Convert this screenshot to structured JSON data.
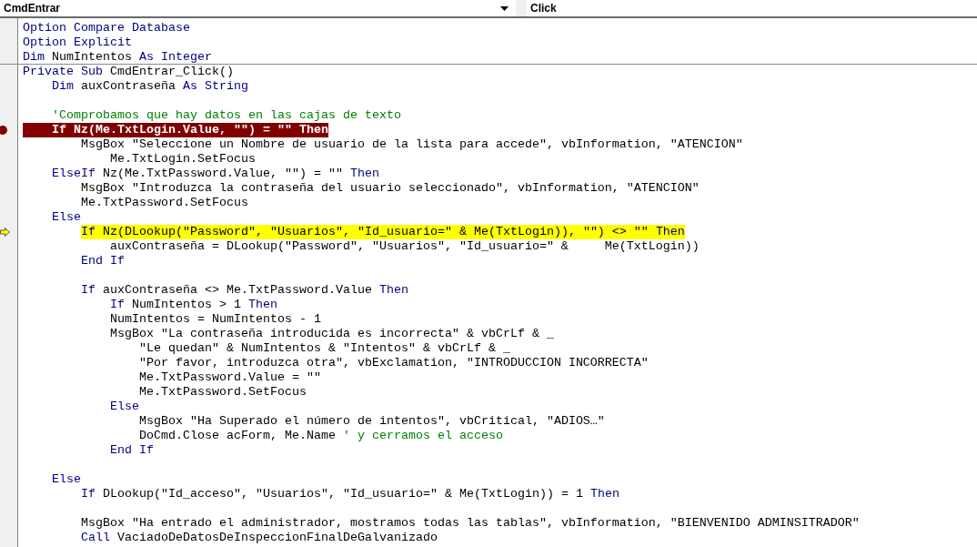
{
  "object_dropdown": {
    "value": "CmdEntrar"
  },
  "procedure_dropdown": {
    "value": "Click"
  },
  "lines": [
    {
      "kind": "code",
      "breakpoint": false,
      "current": false,
      "parts": [
        {
          "kind": "keyword",
          "text": "Option Compare Database"
        }
      ]
    },
    {
      "kind": "code",
      "breakpoint": false,
      "current": false,
      "parts": [
        {
          "kind": "keyword",
          "text": "Option Explicit"
        }
      ]
    },
    {
      "kind": "code",
      "breakpoint": false,
      "current": false,
      "parts": [
        {
          "kind": "keyword",
          "text": "Dim"
        },
        {
          "kind": "plain",
          "text": " NumIntentos "
        },
        {
          "kind": "keyword",
          "text": "As Integer"
        }
      ]
    },
    {
      "kind": "procedure_start",
      "breakpoint": false,
      "current": false,
      "parts": [
        {
          "kind": "keyword",
          "text": "Private Sub"
        },
        {
          "kind": "plain",
          "text": " CmdEntrar_Click()"
        }
      ]
    },
    {
      "kind": "code",
      "breakpoint": false,
      "current": false,
      "parts": [
        {
          "kind": "keyword",
          "text": "    Dim"
        },
        {
          "kind": "plain",
          "text": " auxContraseña "
        },
        {
          "kind": "keyword",
          "text": "As String"
        }
      ]
    },
    {
      "kind": "blank"
    },
    {
      "kind": "code",
      "breakpoint": false,
      "current": false,
      "parts": [
        {
          "kind": "comment",
          "text": "    'Comprobamos que hay datos en las cajas de texto"
        }
      ]
    },
    {
      "kind": "code",
      "breakpoint": true,
      "current": false,
      "parts": [
        {
          "kind": "keyword",
          "text": "    If"
        },
        {
          "kind": "plain",
          "text": " Nz(Me.TxtLogin.Value, \"\") = \"\" "
        },
        {
          "kind": "keyword",
          "text": "Then"
        }
      ]
    },
    {
      "kind": "code",
      "breakpoint": false,
      "current": false,
      "parts": [
        {
          "kind": "plain",
          "text": "        MsgBox \"Seleccione un Nombre de usuario de la lista para accede\", vbInformation, \"ATENCION\""
        }
      ]
    },
    {
      "kind": "code",
      "breakpoint": false,
      "current": false,
      "parts": [
        {
          "kind": "plain",
          "text": "            Me.TxtLogin.SetFocus"
        }
      ]
    },
    {
      "kind": "code",
      "breakpoint": false,
      "current": false,
      "parts": [
        {
          "kind": "keyword",
          "text": "    ElseIf"
        },
        {
          "kind": "plain",
          "text": " Nz(Me.TxtPassword.Value, \"\") = \"\" "
        },
        {
          "kind": "keyword",
          "text": "Then"
        }
      ]
    },
    {
      "kind": "code",
      "breakpoint": false,
      "current": false,
      "parts": [
        {
          "kind": "plain",
          "text": "        MsgBox \"Introduzca la contraseña del usuario seleccionado\", vbInformation, \"ATENCION\""
        }
      ]
    },
    {
      "kind": "code",
      "breakpoint": false,
      "current": false,
      "parts": [
        {
          "kind": "plain",
          "text": "        Me.TxtPassword.SetFocus"
        }
      ]
    },
    {
      "kind": "code",
      "breakpoint": false,
      "current": false,
      "parts": [
        {
          "kind": "keyword",
          "text": "    Else"
        }
      ]
    },
    {
      "kind": "code",
      "breakpoint": false,
      "current": true,
      "parts": [
        {
          "kind": "keyword",
          "text": "        If"
        },
        {
          "kind": "plain",
          "text": " Nz(DLookup(\"Password\", \"Usuarios\", \"Id_usuario=\" & Me(TxtLogin)), \"\") <> \"\" "
        },
        {
          "kind": "keyword",
          "text": "Then"
        }
      ]
    },
    {
      "kind": "code",
      "breakpoint": false,
      "current": false,
      "parts": [
        {
          "kind": "plain",
          "text": "            auxContraseña = DLookup(\"Password\", \"Usuarios\", \"Id_usuario=\" &     Me(TxtLogin))"
        }
      ]
    },
    {
      "kind": "code",
      "breakpoint": false,
      "current": false,
      "parts": [
        {
          "kind": "keyword",
          "text": "        End If"
        }
      ]
    },
    {
      "kind": "blank"
    },
    {
      "kind": "code",
      "breakpoint": false,
      "current": false,
      "parts": [
        {
          "kind": "keyword",
          "text": "        If"
        },
        {
          "kind": "plain",
          "text": " auxContraseña <> Me.TxtPassword.Value "
        },
        {
          "kind": "keyword",
          "text": "Then"
        }
      ]
    },
    {
      "kind": "code",
      "breakpoint": false,
      "current": false,
      "parts": [
        {
          "kind": "keyword",
          "text": "            If"
        },
        {
          "kind": "plain",
          "text": " NumIntentos > 1 "
        },
        {
          "kind": "keyword",
          "text": "Then"
        }
      ]
    },
    {
      "kind": "code",
      "breakpoint": false,
      "current": false,
      "parts": [
        {
          "kind": "plain",
          "text": "            NumIntentos = NumIntentos - 1"
        }
      ]
    },
    {
      "kind": "code",
      "breakpoint": false,
      "current": false,
      "parts": [
        {
          "kind": "plain",
          "text": "            MsgBox \"La contraseña introducida es incorrecta\" & vbCrLf & _"
        }
      ]
    },
    {
      "kind": "code",
      "breakpoint": false,
      "current": false,
      "parts": [
        {
          "kind": "plain",
          "text": "                \"Le quedan\" & NumIntentos & \"Intentos\" & vbCrLf & _"
        }
      ]
    },
    {
      "kind": "code",
      "breakpoint": false,
      "current": false,
      "parts": [
        {
          "kind": "plain",
          "text": "                \"Por favor, introduzca otra\", vbExclamation, \"INTRODUCCION INCORRECTA\""
        }
      ]
    },
    {
      "kind": "code",
      "breakpoint": false,
      "current": false,
      "parts": [
        {
          "kind": "plain",
          "text": "                Me.TxtPassword.Value = \"\""
        }
      ]
    },
    {
      "kind": "code",
      "breakpoint": false,
      "current": false,
      "parts": [
        {
          "kind": "plain",
          "text": "                Me.TxtPassword.SetFocus"
        }
      ]
    },
    {
      "kind": "code",
      "breakpoint": false,
      "current": false,
      "parts": [
        {
          "kind": "keyword",
          "text": "            Else"
        }
      ]
    },
    {
      "kind": "code",
      "breakpoint": false,
      "current": false,
      "parts": [
        {
          "kind": "plain",
          "text": "                MsgBox \"Ha Superado el número de intentos\", vbCritical, \"ADIOS…\""
        }
      ]
    },
    {
      "kind": "code",
      "breakpoint": false,
      "current": false,
      "parts": [
        {
          "kind": "plain",
          "text": "                DoCmd.Close acForm, Me.Name "
        },
        {
          "kind": "comment",
          "text": "' y cerramos el acceso"
        }
      ]
    },
    {
      "kind": "code",
      "breakpoint": false,
      "current": false,
      "parts": [
        {
          "kind": "keyword",
          "text": "            End If"
        }
      ]
    },
    {
      "kind": "blank"
    },
    {
      "kind": "code",
      "breakpoint": false,
      "current": false,
      "parts": [
        {
          "kind": "keyword",
          "text": "    Else"
        }
      ]
    },
    {
      "kind": "code",
      "breakpoint": false,
      "current": false,
      "parts": [
        {
          "kind": "keyword",
          "text": "        If"
        },
        {
          "kind": "plain",
          "text": " DLookup(\"Id_acceso\", \"Usuarios\", \"Id_usuario=\" & Me(TxtLogin)) = 1 "
        },
        {
          "kind": "keyword",
          "text": "Then"
        }
      ]
    },
    {
      "kind": "blank"
    },
    {
      "kind": "code",
      "breakpoint": false,
      "current": false,
      "parts": [
        {
          "kind": "plain",
          "text": "        MsgBox \"Ha entrado el administrador, mostramos todas las tablas\", vbInformation, \"BIENVENIDO ADMINSITRADOR\""
        }
      ]
    },
    {
      "kind": "code",
      "breakpoint": false,
      "current": false,
      "parts": [
        {
          "kind": "keyword",
          "text": "        Call"
        },
        {
          "kind": "plain",
          "text": " VaciadoDeDatosDeInspeccionFinalDeGalvanizado"
        }
      ]
    }
  ]
}
